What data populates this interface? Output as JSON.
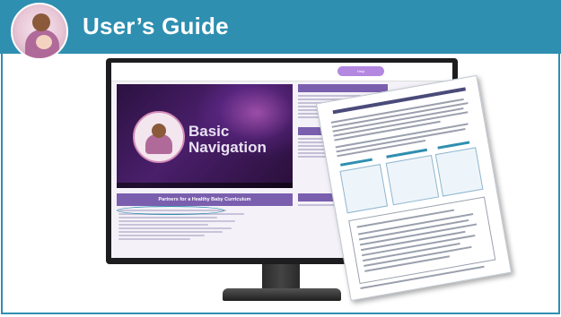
{
  "slide": {
    "title": "User’s Guide"
  },
  "monitor": {
    "nav": {
      "brand_line1": "",
      "brand_line2": "",
      "items": [
        "",
        "",
        ""
      ],
      "help_label": "Help",
      "signout_label": ""
    },
    "video": {
      "badge_text": "Partners for a Healthy Baby",
      "title_line1": "Basic",
      "title_line2": "Navigation"
    },
    "partners_heading": "Partners for a Healthy Baby Curriculum"
  },
  "colors": {
    "header": "#2f8fb0",
    "accent_purple": "#7a5fae",
    "help_pill": "#b488e0"
  },
  "icons": {
    "logo": "mother-and-baby-logo"
  }
}
